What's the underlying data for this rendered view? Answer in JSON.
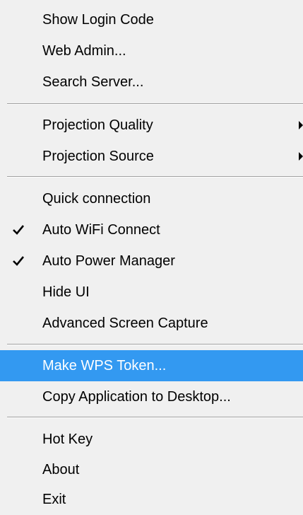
{
  "menu": {
    "items": [
      {
        "label": "Show Login Code"
      },
      {
        "label": "Web Admin..."
      },
      {
        "label": "Search Server..."
      },
      {
        "label": "Projection Quality",
        "submenu": true
      },
      {
        "label": "Projection Source",
        "submenu": true
      },
      {
        "label": "Quick connection"
      },
      {
        "label": "Auto WiFi Connect",
        "checked": true
      },
      {
        "label": "Auto Power Manager",
        "checked": true
      },
      {
        "label": "Hide UI"
      },
      {
        "label": "Advanced Screen Capture"
      },
      {
        "label": "Make WPS Token...",
        "highlighted": true
      },
      {
        "label": "Copy Application to Desktop..."
      },
      {
        "label": "Hot Key"
      },
      {
        "label": "About"
      },
      {
        "label": "Exit"
      }
    ]
  },
  "colors": {
    "menu_background": "#f0f0f0",
    "highlight": "#3399f1",
    "highlight_text": "#ffffff",
    "text": "#000000",
    "separator": "#a0a0a0"
  },
  "icons": {
    "check": "check-icon",
    "submenu": "submenu-arrow-icon"
  }
}
